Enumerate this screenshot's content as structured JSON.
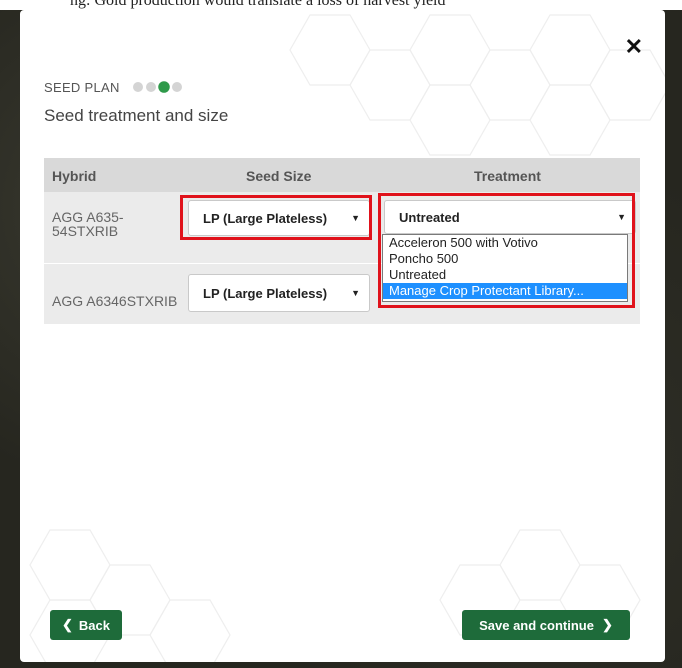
{
  "background_caption": "ng: Gold production would translate a loss of harvest yield",
  "dialog": {
    "close_glyph": "✕",
    "step_label": "SEED PLAN",
    "step_count": 4,
    "active_step": 3,
    "subtitle": "Seed treatment and size"
  },
  "table": {
    "headers": {
      "hybrid": "Hybrid",
      "seed_size": "Seed Size",
      "treatment": "Treatment"
    },
    "rows": [
      {
        "hybrid": "AGG A635-\n54STXRIB",
        "seed_size": "LP (Large Plateless)",
        "treatment": "Untreated"
      },
      {
        "hybrid": "AGG A6346STXRIB",
        "seed_size": "LP (Large Plateless)",
        "treatment": ""
      }
    ]
  },
  "dropdown": {
    "options": [
      "Acceleron 500 with Votivo",
      "Poncho 500",
      "Untreated",
      "Manage Crop Protectant Library..."
    ],
    "highlighted_index": 3
  },
  "buttons": {
    "back": "Back",
    "save": "Save and continue"
  },
  "colors": {
    "accent_green": "#1e6b3a",
    "active_dot": "#2f9a4a",
    "highlight_red": "#e0121b",
    "selection_blue": "#1e90ff"
  }
}
